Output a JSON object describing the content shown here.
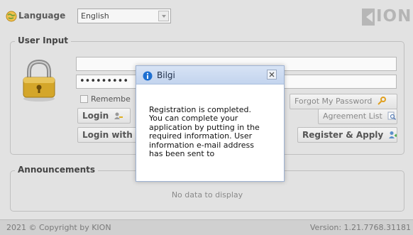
{
  "language": {
    "label": "Language",
    "selected": "English"
  },
  "logo": {
    "text": "ION"
  },
  "login": {
    "legend": "User Input",
    "password_mask": "•••••••••",
    "remember_label": "Remembe",
    "login_button": "Login",
    "login_with_button": "Login with I",
    "forgot_password": "Forgot My Password",
    "agreement_list": "Agreement List",
    "register_apply": "Register & Apply"
  },
  "announcements": {
    "legend": "Announcements",
    "empty_text": "No data to display"
  },
  "footer": {
    "copyright": "2021 © Copyright by KION",
    "version": "Version: 1.21.7768.31181"
  },
  "dialog": {
    "title": "Bilgi",
    "message": "Registration is completed.\nYou can complete your\napplication by putting in the\nrequired information. User\ninformation e-mail address\nhas been sent to"
  },
  "icons": {
    "language": "globe-icon",
    "lock": "padlock-icon",
    "info": "info-icon",
    "close": "close-icon"
  },
  "colors": {
    "page_bg": "#e2e2e2",
    "dialog_header": "#c9d8f0",
    "info_blue": "#1e6fd1"
  }
}
